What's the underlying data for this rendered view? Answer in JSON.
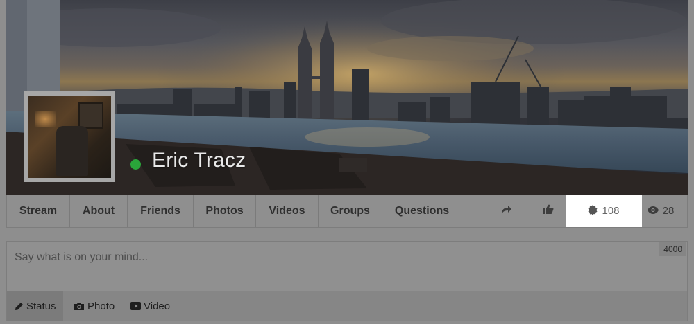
{
  "profile": {
    "name": "Eric Tracz",
    "online_color": "#2aa53a"
  },
  "nav": {
    "tabs": [
      {
        "label": "Stream"
      },
      {
        "label": "About"
      },
      {
        "label": "Friends"
      },
      {
        "label": "Photos"
      },
      {
        "label": "Videos"
      },
      {
        "label": "Groups"
      },
      {
        "label": "Questions"
      }
    ],
    "actions": {
      "share_icon": "share-icon",
      "like_icon": "thumbs-up-icon",
      "badge_icon": "badge-icon",
      "badge_count": "108",
      "views_icon": "eye-icon",
      "views_count": "28"
    }
  },
  "composer": {
    "placeholder": "Say what is on your mind...",
    "char_limit": "4000",
    "tabs": [
      {
        "label": "Status",
        "icon": "pencil-icon"
      },
      {
        "label": "Photo",
        "icon": "camera-icon"
      },
      {
        "label": "Video",
        "icon": "video-icon"
      }
    ]
  }
}
